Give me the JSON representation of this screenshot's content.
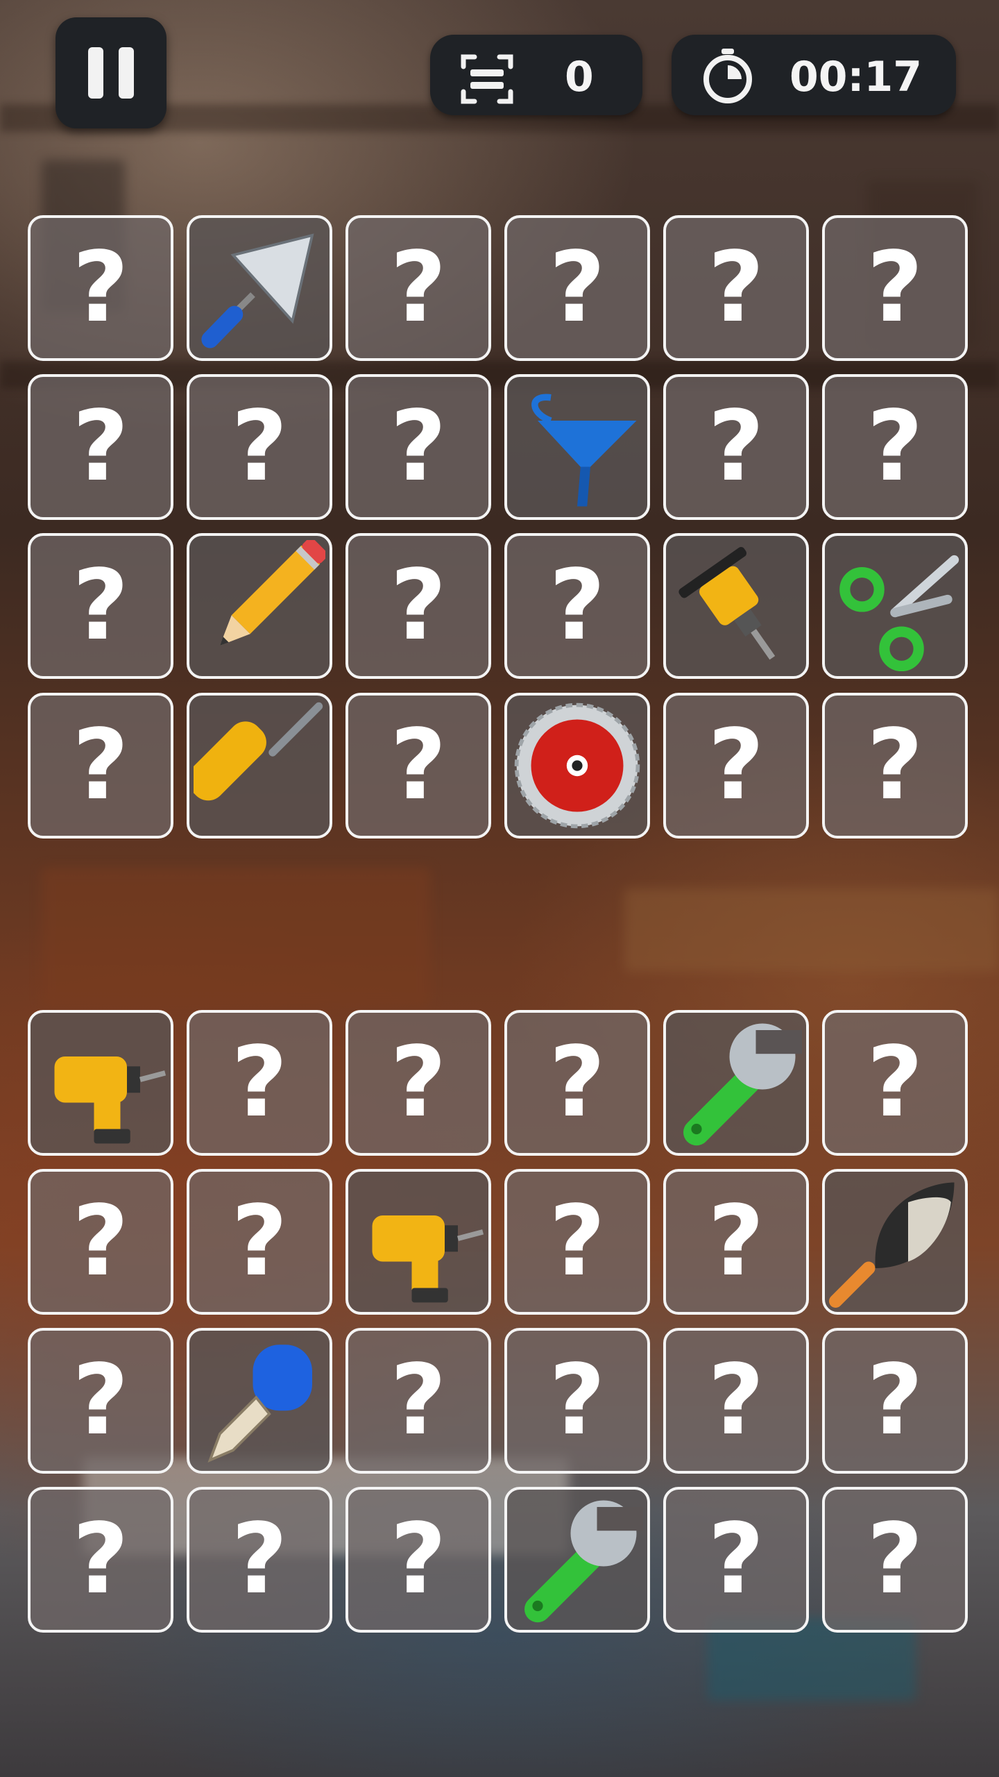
{
  "hud": {
    "moves_icon": "scan-icon",
    "moves_value": "0",
    "timer_icon": "stopwatch-icon",
    "timer_value": "00:17",
    "pause_icon": "pause-icon"
  },
  "hidden_symbol": "?",
  "board": [
    [
      "hidden",
      "trowel",
      "hidden",
      "hidden",
      "hidden",
      "hidden"
    ],
    [
      "hidden",
      "hidden",
      "hidden",
      "funnel",
      "hidden",
      "hidden"
    ],
    [
      "hidden",
      "pencil",
      "hidden",
      "hidden",
      "jackhammer",
      "scissors"
    ],
    [
      "hidden",
      "screwdriver",
      "hidden",
      "saw-blade",
      "hidden",
      "hidden"
    ],
    [
      "drill",
      "hidden",
      "hidden",
      "hidden",
      "wrench",
      "hidden"
    ],
    [
      "hidden",
      "hidden",
      "drill",
      "hidden",
      "hidden",
      "shovel"
    ],
    [
      "hidden",
      "dropper",
      "hidden",
      "hidden",
      "hidden",
      "hidden"
    ],
    [
      "hidden",
      "hidden",
      "hidden",
      "wrench",
      "hidden",
      "hidden"
    ]
  ],
  "colors": {
    "hud_bg": "#1f2226",
    "card_border": "#f4f4f4",
    "card_face": "#706868"
  }
}
